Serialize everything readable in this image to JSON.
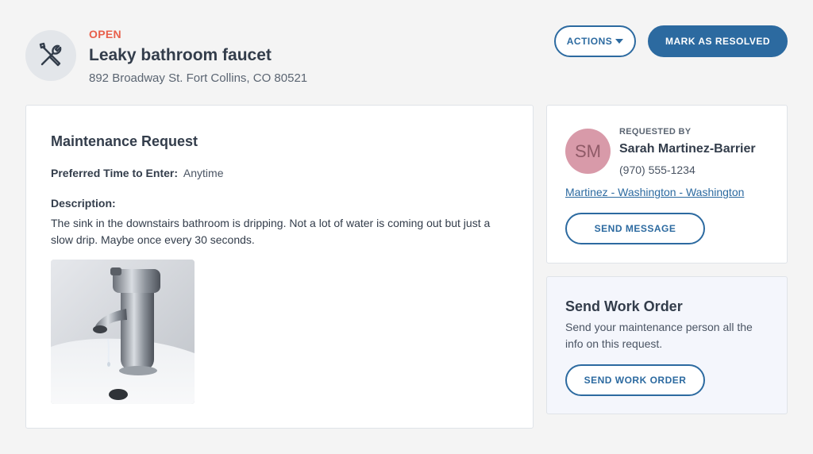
{
  "request": {
    "status": "OPEN",
    "title": "Leaky bathroom faucet",
    "address": "892 Broadway St. Fort Collins, CO 80521"
  },
  "toolbar": {
    "actions_label": "ACTIONS",
    "resolve_label": "MARK AS RESOLVED"
  },
  "details": {
    "heading": "Maintenance Request",
    "preferred_label": "Preferred Time to Enter:",
    "preferred_value": "Anytime",
    "description_label": "Description:",
    "description_text": "The sink in the downstairs bathroom is dripping. Not a lot of water is coming out but just a slow drip. Maybe once every 30 seconds."
  },
  "requester": {
    "label": "REQUESTED BY",
    "initials": "SM",
    "name": "Sarah Martinez-Barrier",
    "phone": "(970) 555-1234",
    "property_link": "Martinez - Washington - Washington",
    "send_message_label": "SEND MESSAGE",
    "avatar_color": "#d89aa9"
  },
  "work_order": {
    "title": "Send Work Order",
    "description": "Send your maintenance person all the info on this request.",
    "button_label": "SEND WORK ORDER"
  },
  "colors": {
    "accent": "#2c6aa0",
    "status_open": "#e8604c"
  }
}
